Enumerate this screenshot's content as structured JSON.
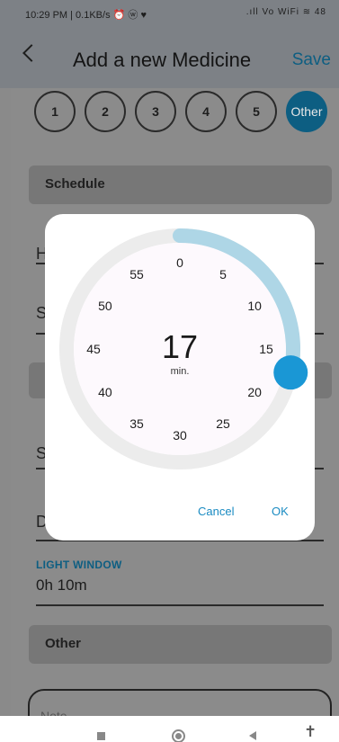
{
  "status_bar": {
    "left": "10:29 PM | 0.1KB/s ⏰ ⓦ ♥",
    "right": ".ıll Vo WiFi ≋ 48"
  },
  "app_bar": {
    "title": "Add a new Medicine",
    "save_label": "Save"
  },
  "dose_options": [
    "1",
    "2",
    "3",
    "4",
    "5",
    "Other"
  ],
  "dose_selected": "Other",
  "sections": {
    "schedule": "Schedule",
    "other": "Other"
  },
  "peek": {
    "h": "H",
    "s": "S",
    "d": "D",
    "s2": "S"
  },
  "light_window": {
    "label": "LIGHT WINDOW",
    "value": "0h 10m"
  },
  "note_placeholder": "Note",
  "picker": {
    "value": "17",
    "unit": "min.",
    "labels": [
      "0",
      "5",
      "10",
      "15",
      "20",
      "25",
      "30",
      "35",
      "40",
      "45",
      "50",
      "55"
    ],
    "selected_fraction": 0.2833,
    "cancel_label": "Cancel",
    "ok_label": "OK",
    "accent": "#1a97d5",
    "arc_color": "#aed6e6",
    "track_color": "#ececec"
  }
}
